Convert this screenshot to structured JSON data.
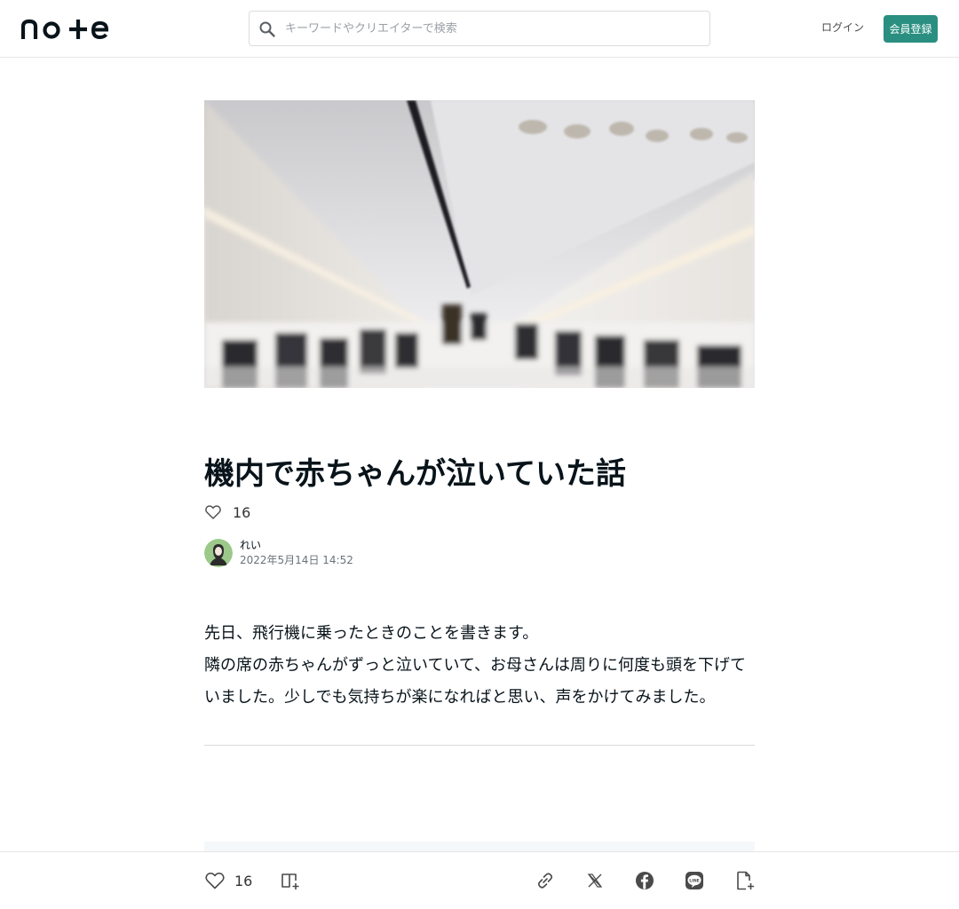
{
  "header": {
    "logo_text": "note",
    "search_placeholder": "キーワードやクリエイターで検索",
    "login_label": "ログイン",
    "signup_label": "会員登録",
    "accent_color": "#2a8f80"
  },
  "article": {
    "title": "機内で赤ちゃんが泣いていた話",
    "like_count": "16",
    "author_name": "れい",
    "date": "2022年5月14日 14:52",
    "paragraphs": [
      "先日、飛行機に乗ったときのことを書きます。",
      "隣の席の赤ちゃんがずっと泣いていて、お母さんは周りに何度も頭を下げていました。少しでも気持ちが楽になればと思い、声をかけてみました。"
    ]
  },
  "footer": {
    "like_count": "16",
    "icons": [
      "heart-icon",
      "magazine-add-icon",
      "link-icon",
      "x-icon",
      "facebook-icon",
      "line-icon",
      "embed-icon"
    ]
  }
}
